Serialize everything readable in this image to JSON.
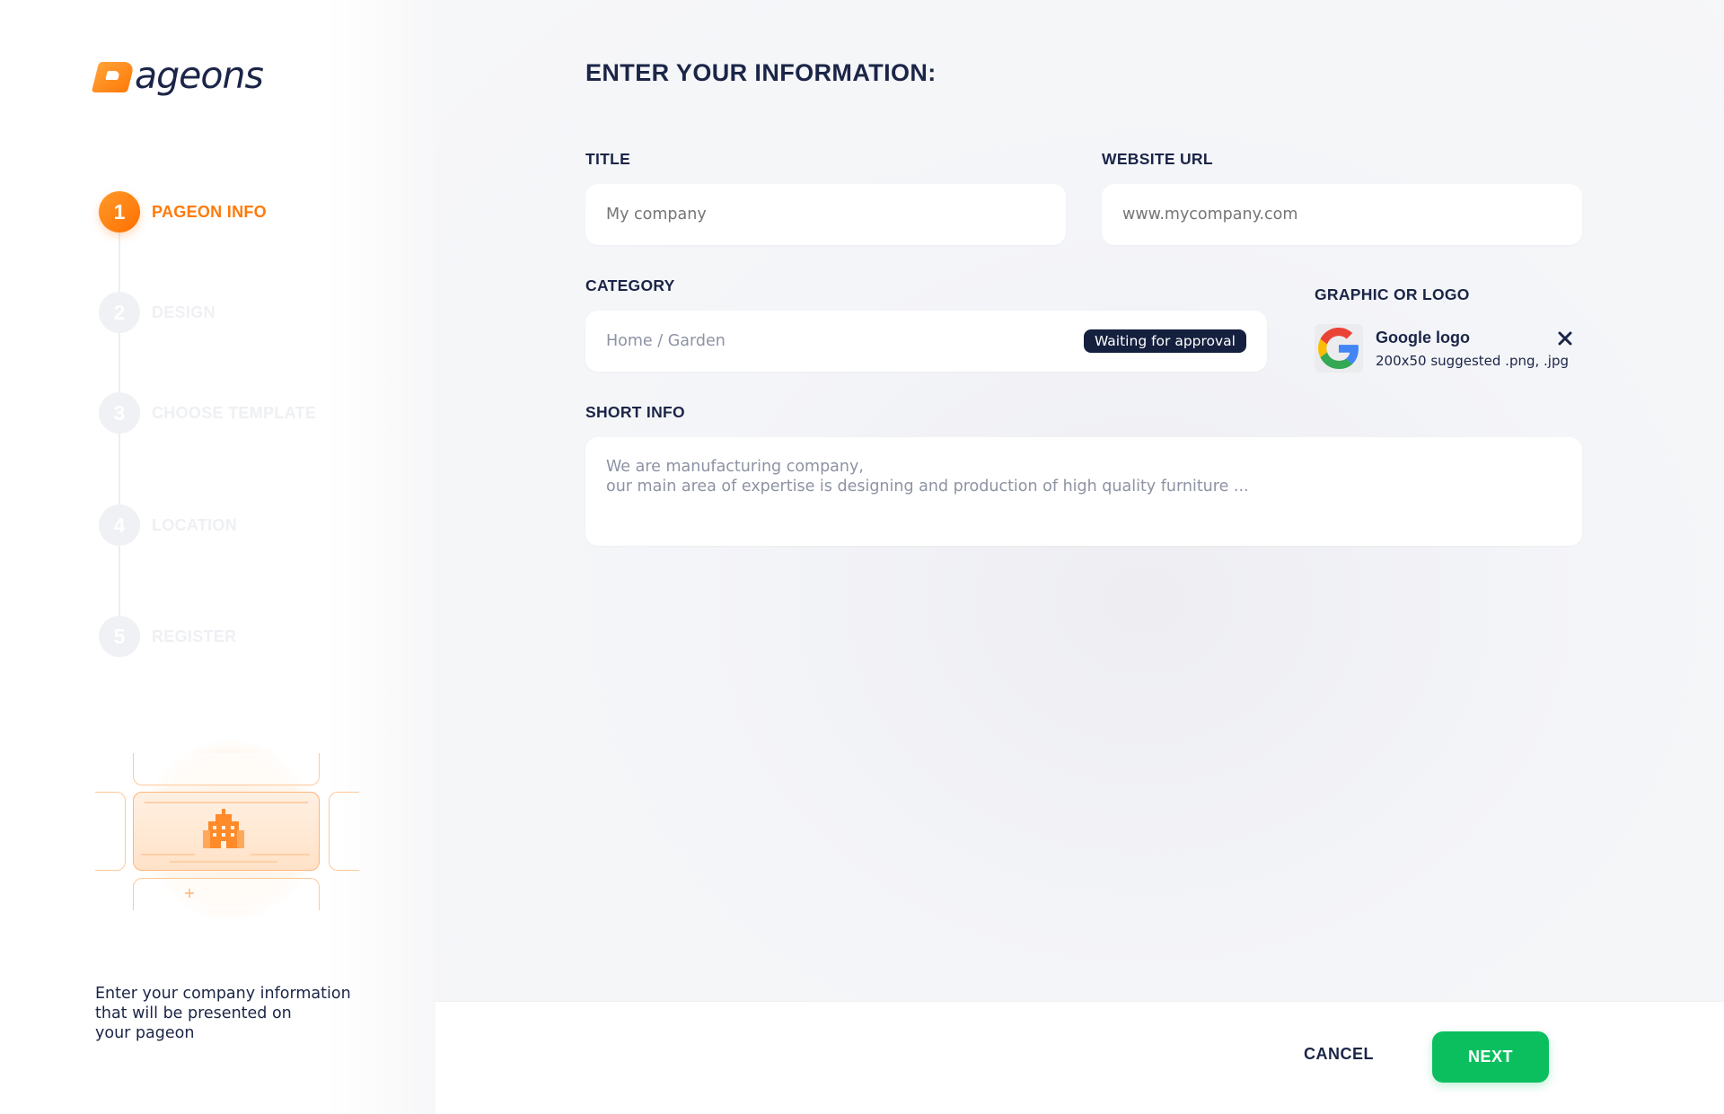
{
  "brand": {
    "logo_text": "ageons",
    "accent_color": "#ff7a08",
    "primary_text_color": "#1b2547",
    "success_color": "#0bbf5f"
  },
  "sidebar": {
    "steps": [
      {
        "number": "1",
        "label": "PAGEON INFO",
        "active": true
      },
      {
        "number": "2",
        "label": "DESIGN",
        "active": false
      },
      {
        "number": "3",
        "label": "CHOOSE TEMPLATE",
        "active": false
      },
      {
        "number": "4",
        "label": "LOCATION",
        "active": false
      },
      {
        "number": "5",
        "label": "REGISTER",
        "active": false
      }
    ],
    "illustration_icon": "building-cards-illustration",
    "caption": "Enter your company  information\nthat will be presented on\nyour pageon"
  },
  "form": {
    "title": "ENTER YOUR INFORMATION:",
    "title_field": {
      "label": "TITLE",
      "placeholder": "My company"
    },
    "website_field": {
      "label": "WEBSITE URL",
      "placeholder": "www.mycompany.com"
    },
    "category_field": {
      "label": "CATEGORY",
      "value": "Home / Garden",
      "badge": "Waiting for approval"
    },
    "logo_field": {
      "label": "GRAPHIC OR LOGO",
      "file_name": "Google logo",
      "hint": "200x50 suggested .png, .jpg",
      "icon": "google-g-icon",
      "remove_icon": "close-icon"
    },
    "short_info_field": {
      "label": "SHORT INFO",
      "value": "We are manufacturing company,\nour main area of expertise is designing and production of high quality furniture ..."
    }
  },
  "footer": {
    "cancel_label": "CANCEL",
    "next_label": "NEXT"
  }
}
